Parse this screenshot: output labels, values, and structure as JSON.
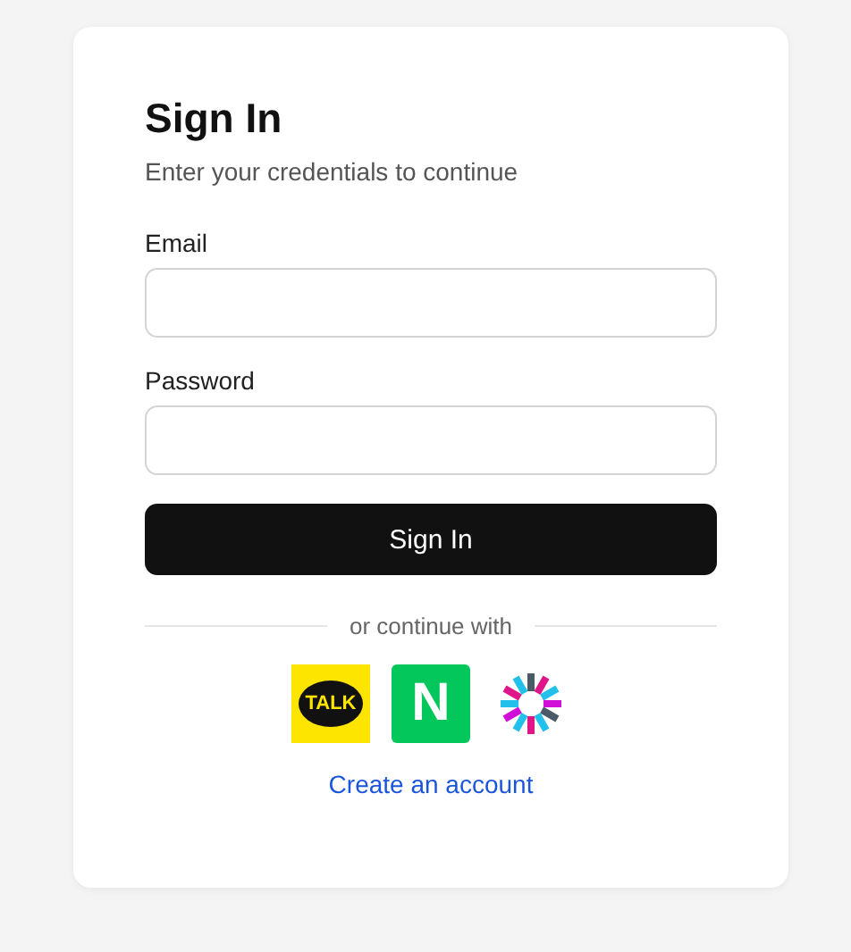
{
  "title": "Sign In",
  "subtitle": "Enter your credentials to continue",
  "fields": [
    {
      "label": "Email"
    },
    {
      "label": "Password"
    }
  ],
  "submit": "Sign In",
  "divider": "or continue with",
  "social": [
    {
      "kind": "kakao",
      "label": "TALK"
    },
    {
      "kind": "naver",
      "label": "N"
    },
    {
      "kind": "burst"
    }
  ],
  "link": "Create an account"
}
